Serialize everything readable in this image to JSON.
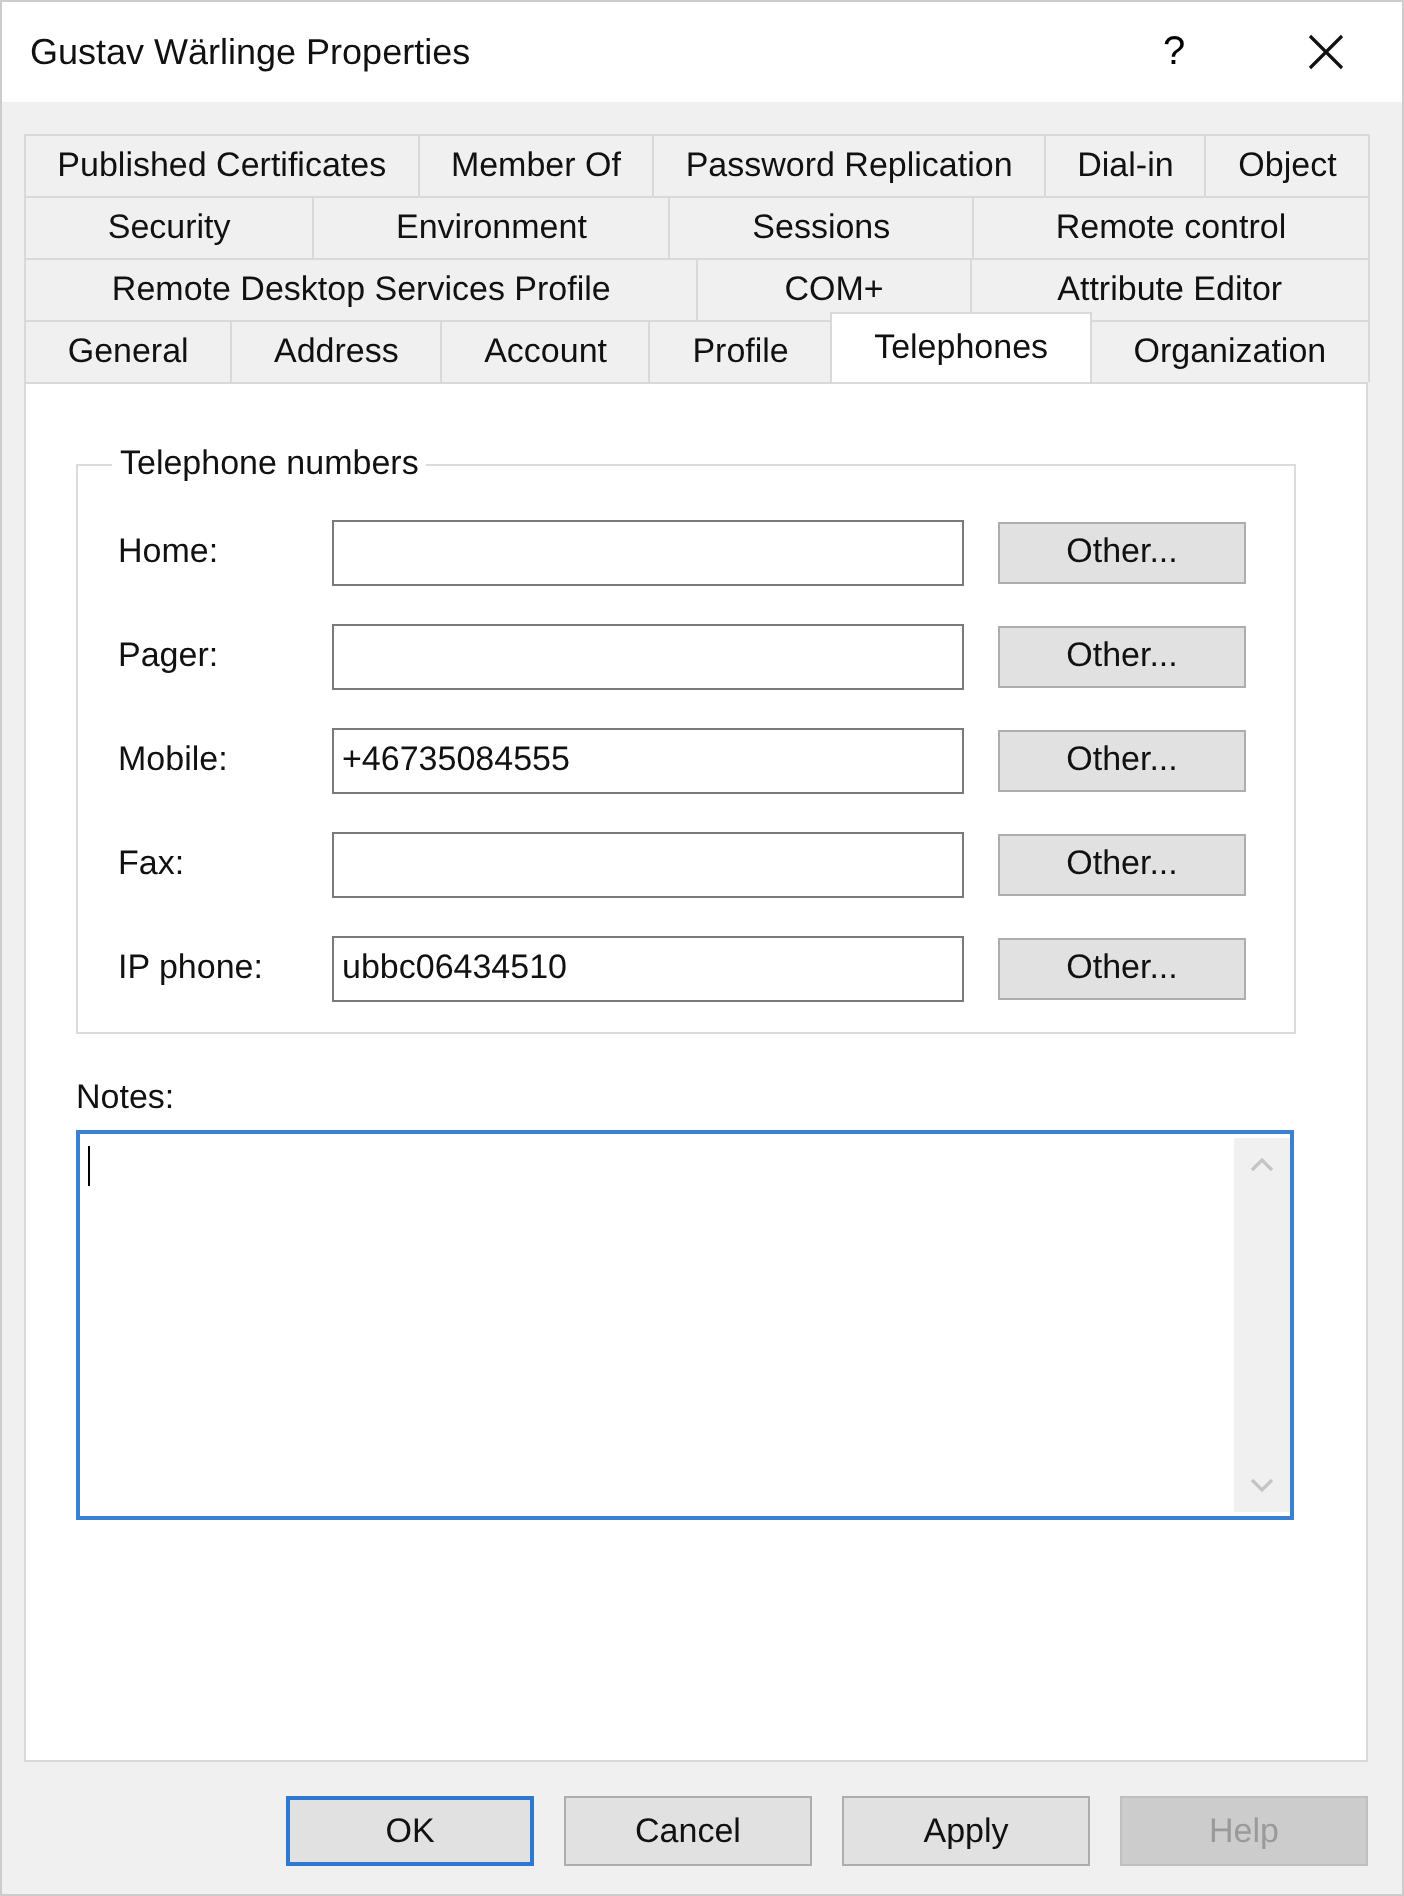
{
  "window": {
    "title": "Gustav Wärlinge Properties",
    "help_glyph": "?"
  },
  "tab_rows": [
    [
      {
        "label": "Published Certificates",
        "selected": false
      },
      {
        "label": "Member Of",
        "selected": false
      },
      {
        "label": "Password Replication",
        "selected": false
      },
      {
        "label": "Dial-in",
        "selected": false
      },
      {
        "label": "Object",
        "selected": false
      }
    ],
    [
      {
        "label": "Security",
        "selected": false
      },
      {
        "label": "Environment",
        "selected": false
      },
      {
        "label": "Sessions",
        "selected": false
      },
      {
        "label": "Remote control",
        "selected": false
      }
    ],
    [
      {
        "label": "Remote Desktop Services Profile",
        "selected": false
      },
      {
        "label": "COM+",
        "selected": false
      },
      {
        "label": "Attribute Editor",
        "selected": false
      }
    ],
    [
      {
        "label": "General",
        "selected": false
      },
      {
        "label": "Address",
        "selected": false
      },
      {
        "label": "Account",
        "selected": false
      },
      {
        "label": "Profile",
        "selected": false
      },
      {
        "label": "Telephones",
        "selected": true
      },
      {
        "label": "Organization",
        "selected": false
      }
    ]
  ],
  "telephone_numbers": {
    "title": "Telephone numbers",
    "rows": [
      {
        "label": "Home:",
        "value": "",
        "button": "Other..."
      },
      {
        "label": "Pager:",
        "value": "",
        "button": "Other..."
      },
      {
        "label": "Mobile:",
        "value": "+46735084555",
        "button": "Other..."
      },
      {
        "label": "Fax:",
        "value": "",
        "button": "Other..."
      },
      {
        "label": "IP phone:",
        "value": "ubbc06434510",
        "button": "Other..."
      }
    ]
  },
  "notes": {
    "label": "Notes:",
    "focused": true
  },
  "buttons": [
    {
      "label": "OK",
      "default": true,
      "disabled": false
    },
    {
      "label": "Cancel",
      "default": false,
      "disabled": false
    },
    {
      "label": "Apply",
      "default": false,
      "disabled": false
    },
    {
      "label": "Help",
      "default": false,
      "disabled": true
    }
  ]
}
